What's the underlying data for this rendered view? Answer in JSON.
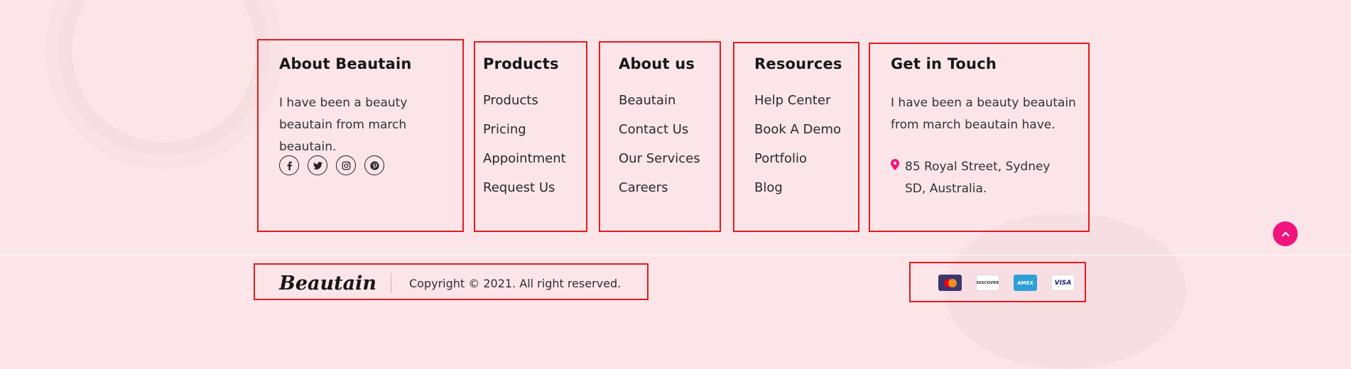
{
  "about": {
    "title": "About Beautain",
    "text": "I have been a beauty beautain from march beautain.",
    "socials": [
      "facebook-icon",
      "twitter-icon",
      "instagram-icon",
      "pinterest-icon"
    ]
  },
  "products": {
    "title": "Products",
    "links": [
      "Products",
      "Pricing",
      "Appointment",
      "Request Us"
    ]
  },
  "about_us": {
    "title": "About us",
    "links": [
      "Beautain",
      "Contact Us",
      "Our Services",
      "Careers"
    ]
  },
  "resources": {
    "title": "Resources",
    "links": [
      "Help Center",
      "Book A Demo",
      "Portfolio",
      "Blog"
    ]
  },
  "contact": {
    "title": "Get in Touch",
    "text": "I have been a beauty beautain from march beautain have.",
    "address": "85 Royal Street, Sydney SD, Australia."
  },
  "footer": {
    "brand": "Beautain",
    "copyright": "Copyright © 2021. All right reserved.",
    "payments": [
      {
        "name": "mastercard-icon",
        "label": ""
      },
      {
        "name": "discover-icon",
        "label": "DISCOVER"
      },
      {
        "name": "amex-icon",
        "label": "AMEX"
      },
      {
        "name": "visa-icon",
        "label": "VISA"
      }
    ]
  },
  "colors": {
    "background": "#fbe5e9",
    "accent": "#f0147c",
    "highlight": "#e41b1b"
  }
}
